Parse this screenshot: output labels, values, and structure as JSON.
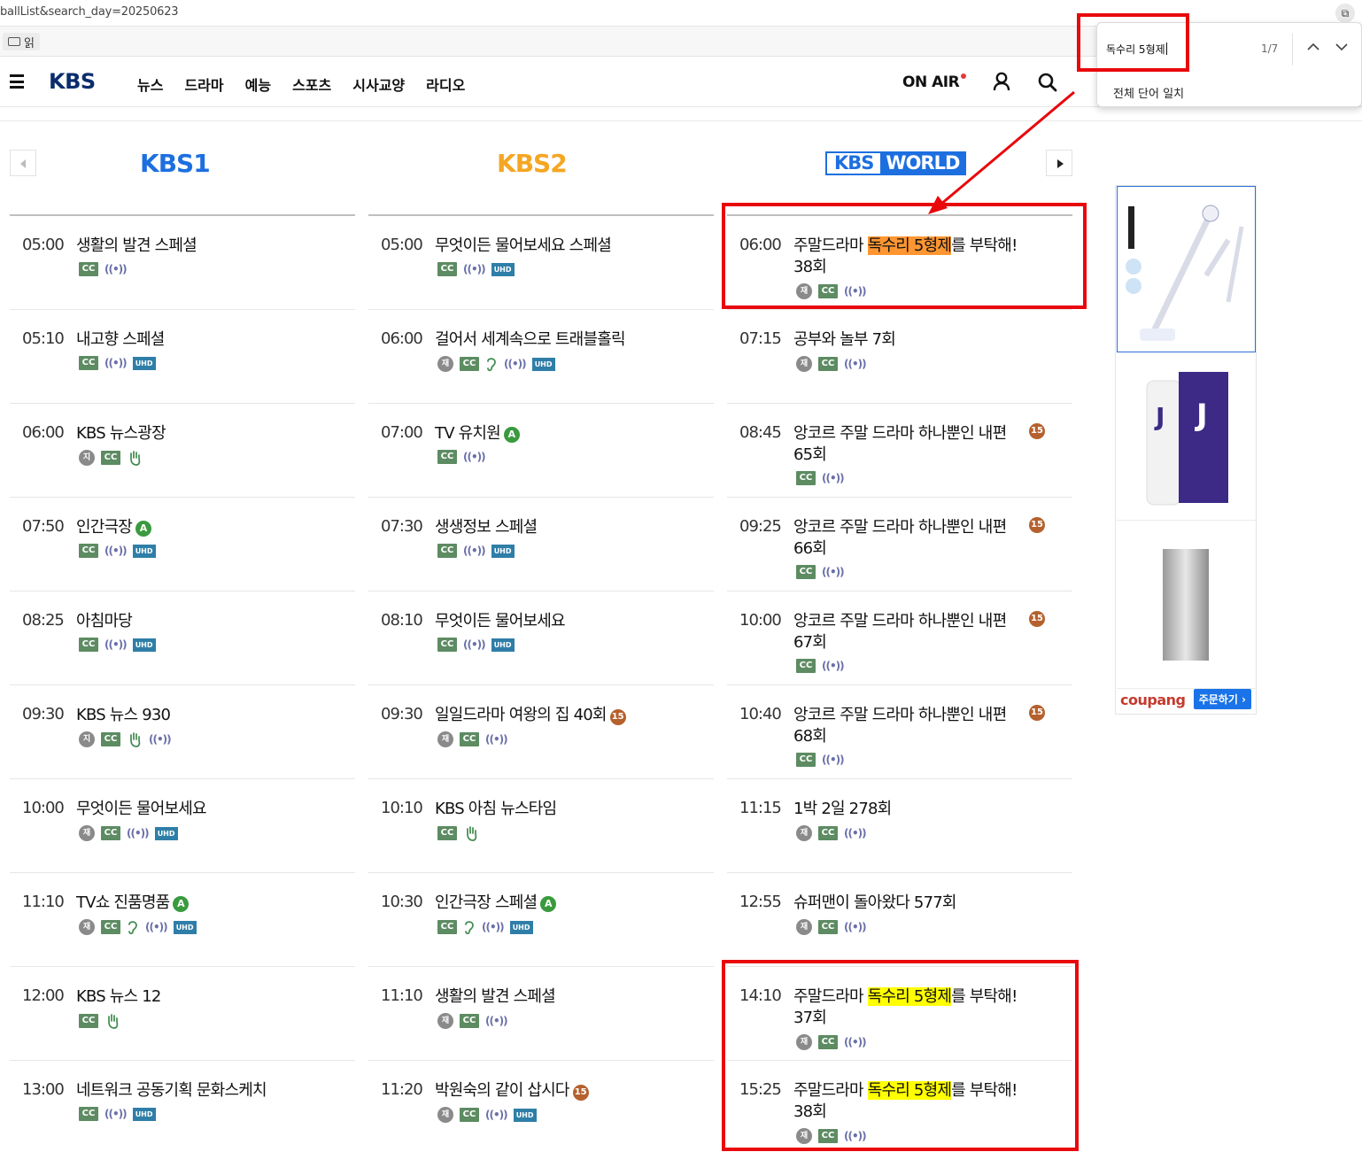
{
  "browser": {
    "url": "ballList&search_day=20250623",
    "bookmark_label": "읽"
  },
  "header": {
    "logo": "KBS",
    "nav": [
      "뉴스",
      "드라마",
      "예능",
      "스포츠",
      "시사교양",
      "라디오"
    ],
    "onair": "ON AIR"
  },
  "channels": {
    "kbs1": "KBS1",
    "kbs2": "KBS2",
    "world_a": "KBS",
    "world_b": "WORLD"
  },
  "schedule": {
    "kbs1": [
      {
        "time": "05:00",
        "title": "생활의 발견 스페셜",
        "badges": [
          "cc",
          "live"
        ]
      },
      {
        "time": "05:10",
        "title": "내고향 스페셜",
        "badges": [
          "cc",
          "live",
          "uhd"
        ]
      },
      {
        "time": "06:00",
        "title": "KBS 뉴스광장",
        "badges": [
          "ji",
          "cc",
          "sign"
        ]
      },
      {
        "time": "07:50",
        "title": "인간극장",
        "grade": "A",
        "badges": [
          "cc",
          "live",
          "uhd"
        ]
      },
      {
        "time": "08:25",
        "title": "아침마당",
        "badges": [
          "cc",
          "live",
          "uhd"
        ]
      },
      {
        "time": "09:30",
        "title": "KBS 뉴스 930",
        "badges": [
          "ji",
          "cc",
          "sign",
          "live"
        ]
      },
      {
        "time": "10:00",
        "title": "무엇이든 물어보세요",
        "badges": [
          "re",
          "cc",
          "live",
          "uhd"
        ]
      },
      {
        "time": "11:10",
        "title": "TV쇼 진품명품",
        "grade": "A",
        "badges": [
          "re",
          "cc",
          "ear",
          "live",
          "uhd"
        ]
      },
      {
        "time": "12:00",
        "title": "KBS 뉴스 12",
        "badges": [
          "cc",
          "sign"
        ]
      },
      {
        "time": "13:00",
        "title": "네트워크 공동기획 문화스케치",
        "badges": [
          "cc",
          "live",
          "uhd"
        ]
      }
    ],
    "kbs2": [
      {
        "time": "05:00",
        "title": "무엇이든 물어보세요 스페셜",
        "badges": [
          "cc",
          "live",
          "uhd"
        ]
      },
      {
        "time": "06:00",
        "title": "걸어서 세계속으로 트래블홀릭",
        "badges": [
          "re",
          "cc",
          "ear",
          "live",
          "uhd"
        ]
      },
      {
        "time": "07:00",
        "title": "TV 유치원",
        "grade": "A",
        "badges": [
          "cc",
          "live"
        ]
      },
      {
        "time": "07:30",
        "title": "생생정보 스페셜",
        "badges": [
          "cc",
          "live",
          "uhd"
        ]
      },
      {
        "time": "08:10",
        "title": "무엇이든 물어보세요",
        "badges": [
          "cc",
          "live",
          "uhd"
        ]
      },
      {
        "time": "09:30",
        "title": "일일드라마 여왕의 집 40회",
        "grade": "15",
        "badges": [
          "re",
          "cc",
          "live"
        ]
      },
      {
        "time": "10:10",
        "title": "KBS 아침 뉴스타임",
        "badges": [
          "cc",
          "sign"
        ]
      },
      {
        "time": "10:30",
        "title": "인간극장 스페셜",
        "grade": "A",
        "badges": [
          "cc",
          "ear",
          "live",
          "uhd"
        ]
      },
      {
        "time": "11:10",
        "title": "생활의 발견 스페셜",
        "badges": [
          "re",
          "cc",
          "live"
        ]
      },
      {
        "time": "11:20",
        "title": "박원숙의 같이 삽시다",
        "grade": "15",
        "badges": [
          "re",
          "cc",
          "live",
          "uhd"
        ]
      }
    ],
    "world": [
      {
        "time": "06:00",
        "pre": "주말드라마 ",
        "hl": "독수리 5형제",
        "post": "를 부탁해!",
        "line2": "38회",
        "current": true,
        "badges": [
          "re",
          "cc",
          "live"
        ]
      },
      {
        "time": "07:15",
        "title": "공부와 놀부 7회",
        "badges": [
          "re",
          "cc",
          "live"
        ]
      },
      {
        "time": "08:45",
        "title": "앙코르 주말 드라마 하나뿐인 내편",
        "line2": "65회",
        "age": "15",
        "badges": [
          "cc",
          "live"
        ]
      },
      {
        "time": "09:25",
        "title": "앙코르 주말 드라마 하나뿐인 내편",
        "line2": "66회",
        "age": "15",
        "badges": [
          "cc",
          "live"
        ]
      },
      {
        "time": "10:00",
        "title": "앙코르 주말 드라마 하나뿐인 내편",
        "line2": "67회",
        "age": "15",
        "badges": [
          "cc",
          "live"
        ]
      },
      {
        "time": "10:40",
        "title": "앙코르 주말 드라마 하나뿐인 내편",
        "line2": "68회",
        "age": "15",
        "badges": [
          "cc",
          "live"
        ]
      },
      {
        "time": "11:15",
        "title": "1박 2일 278회",
        "badges": [
          "re",
          "cc",
          "live"
        ]
      },
      {
        "time": "12:55",
        "title": "슈퍼맨이 돌아왔다 577회",
        "badges": [
          "re",
          "cc",
          "live"
        ]
      },
      {
        "time": "14:10",
        "pre": "주말드라마 ",
        "hl": "독수리 5형제",
        "post": "를 부탁해!",
        "line2": "37회",
        "badges": [
          "re",
          "cc",
          "live"
        ]
      },
      {
        "time": "15:25",
        "pre": "주말드라마 ",
        "hl": "독수리 5형제",
        "post": "를 부탁해!",
        "line2": "38회",
        "badges": [
          "re",
          "cc",
          "live"
        ]
      }
    ]
  },
  "badge_text": {
    "cc": "CC",
    "uhd": "UHD",
    "re": "재",
    "ji": "지",
    "live": "((•))"
  },
  "ad": {
    "brand": "coupang",
    "cta": "주문하기 ›"
  },
  "findbar": {
    "query": "독수리 5형제",
    "count": "1/7",
    "option": "전체 단어 일치"
  },
  "colors": {
    "highlight": "#ffff00",
    "current_highlight": "#ff9632",
    "annotation": "#e8080c"
  }
}
